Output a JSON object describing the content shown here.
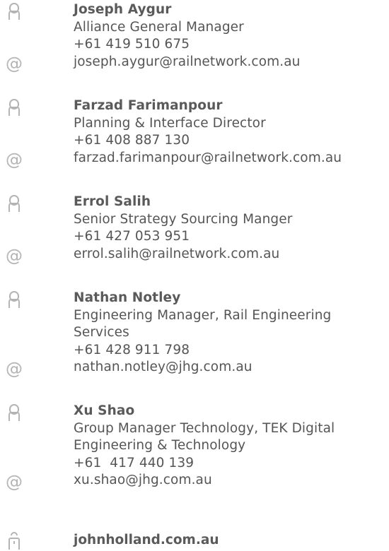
{
  "contacts": [
    {
      "name": "Joseph Aygur",
      "title": "Alliance General Manager",
      "phone": "+61 419 510 675",
      "email": "joseph.aygur@railnetwork.com.au"
    },
    {
      "name": "Farzad Farimanpour",
      "title": "Planning & Interface Director",
      "phone": "+61 408 887 130",
      "email": "farzad.farimanpour@railnetwork.com.au"
    },
    {
      "name": "Errol Salih",
      "title": "Senior Strategy Sourcing Manger",
      "phone": "+61 427 053 951",
      "email": "errol.salih@railnetwork.com.au"
    },
    {
      "name": "Nathan Notley",
      "title": "Engineering Manager, Rail Engineering Services",
      "phone": "+61 428 911 798",
      "email": "nathan.notley@jhg.com.au"
    },
    {
      "name": "Xu Shao",
      "title": "Group Manager Technology, TEK Digital Engineering & Technology",
      "phone": "+61  417 440 139",
      "email": "xu.shao@jhg.com.au"
    }
  ],
  "website": "johnholland.com.au",
  "icons": {
    "person": "person-icon",
    "email": "at-icon",
    "web": "building-icon"
  },
  "colors": {
    "text": "#555555",
    "icon": "#b4b4b4"
  }
}
